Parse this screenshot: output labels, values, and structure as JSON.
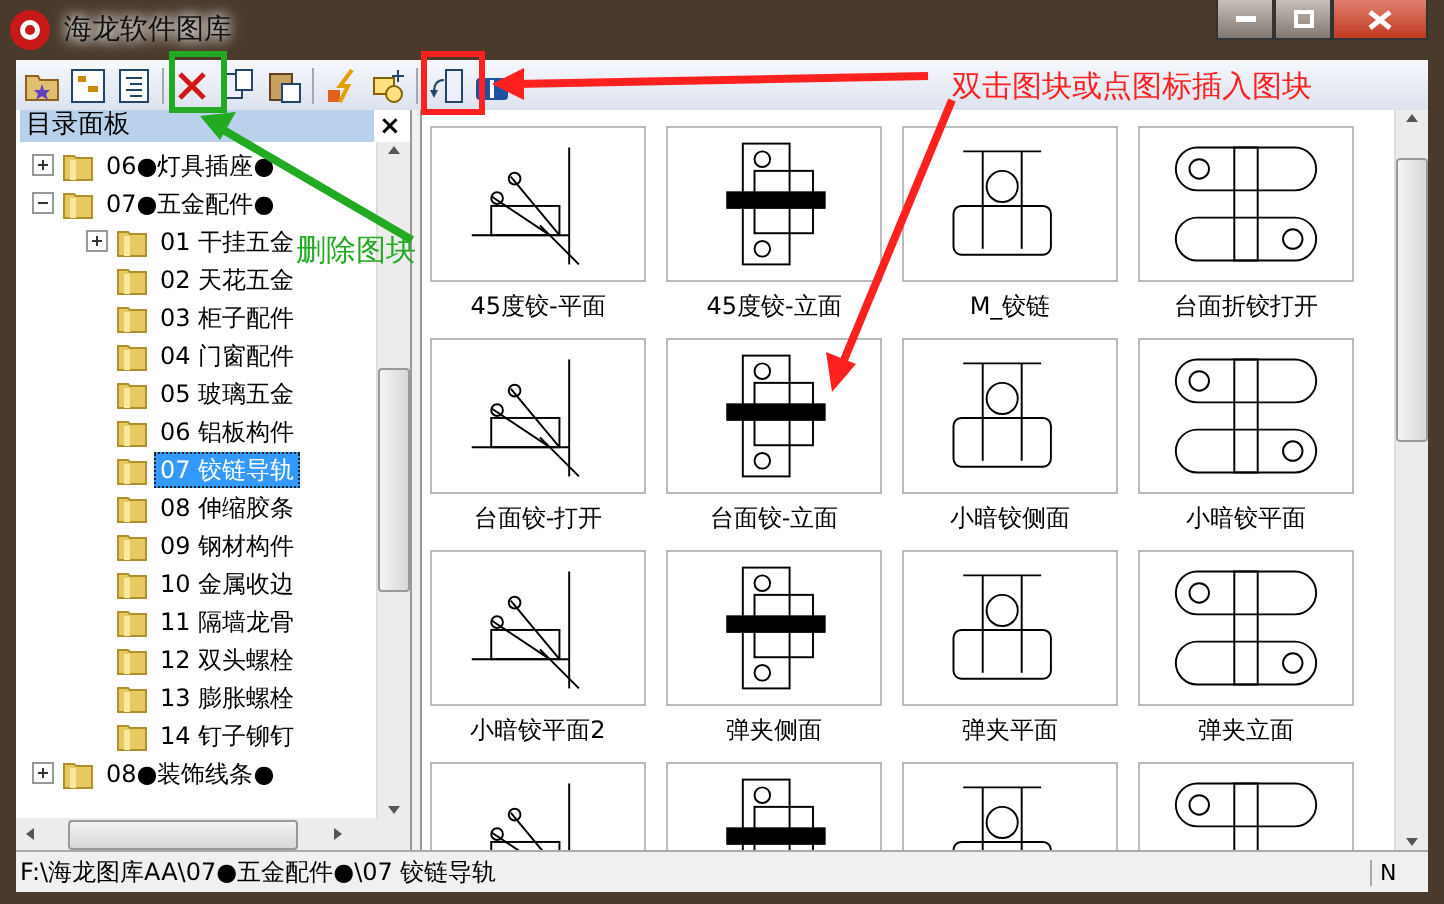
{
  "window": {
    "title": "海龙软件图库"
  },
  "panel": {
    "title": "目录面板",
    "close": "×"
  },
  "tree": [
    {
      "label": "06●灯具插座●",
      "selected": false,
      "expanded": false
    },
    {
      "label": "07●五金配件●",
      "selected": false,
      "expanded": true,
      "children": [
        {
          "label": "01 干挂五金",
          "selected": false,
          "expanded": false
        },
        {
          "label": "02 天花五金",
          "selected": false
        },
        {
          "label": "03 柜子配件",
          "selected": false
        },
        {
          "label": "04 门窗配件",
          "selected": false
        },
        {
          "label": "05 玻璃五金",
          "selected": false
        },
        {
          "label": "06 铝板构件",
          "selected": false
        },
        {
          "label": "07 铰链导轨",
          "selected": true
        },
        {
          "label": "08 伸缩胶条",
          "selected": false
        },
        {
          "label": "09 钢材构件",
          "selected": false
        },
        {
          "label": "10 金属收边",
          "selected": false
        },
        {
          "label": "11 隔墙龙骨",
          "selected": false
        },
        {
          "label": "12 双头螺栓",
          "selected": false
        },
        {
          "label": "13 膨胀螺栓",
          "selected": false
        },
        {
          "label": "14 钉子铆钉",
          "selected": false
        }
      ]
    },
    {
      "label": "08●装饰线条●",
      "selected": false,
      "expanded": false
    }
  ],
  "thumbnails": [
    {
      "label": "45度铰-平面"
    },
    {
      "label": "45度铰-立面"
    },
    {
      "label": "M_铰链"
    },
    {
      "label": "台面折铰打开"
    },
    {
      "label": "台面铰-打开"
    },
    {
      "label": "台面铰-立面"
    },
    {
      "label": "小暗铰侧面"
    },
    {
      "label": "小暗铰平面"
    },
    {
      "label": "小暗铰平面2"
    },
    {
      "label": "弹夹侧面"
    },
    {
      "label": "弹夹平面"
    },
    {
      "label": "弹夹立面"
    },
    {
      "cut_off": true
    },
    {
      "cut_off": true
    },
    {
      "cut_off": true
    },
    {
      "cut_off": true
    }
  ],
  "status_bar": {
    "path": "F:\\海龙图库AA\\07●五金配件●\\07 铰链导轨",
    "mode": "N"
  },
  "annotations": [
    {
      "text": "删除图块",
      "color": "#22aa22"
    },
    {
      "text": "双击图块或点图标插入图块",
      "color": "#ff2020"
    }
  ]
}
